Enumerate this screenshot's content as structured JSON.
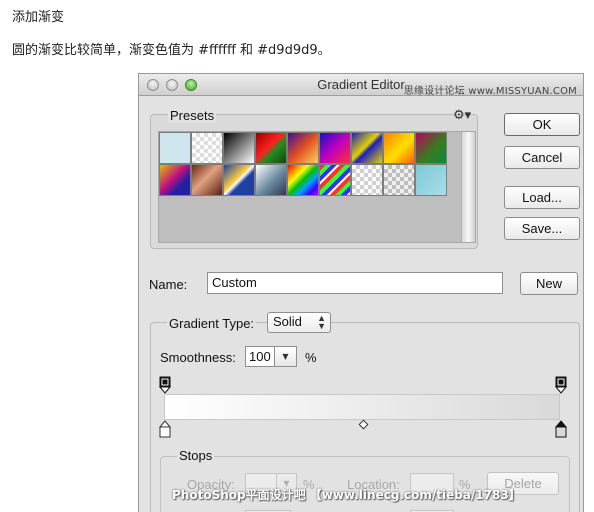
{
  "article": {
    "heading": "添加渐变",
    "body": "圆的渐变比较简单，渐变色值为 #ffffff 和 #d9d9d9。"
  },
  "window": {
    "title": "Gradient Editor",
    "watermark_top": "思缘设计论坛 www.MISSYUAN.COM"
  },
  "presets": {
    "label": "Presets",
    "swatches": [
      "linear-gradient(135deg,#cfe6ee,#cfe6ee)",
      "repeating-conic-gradient(#ddd 0 25%,#fff 0 50%) 0 0/8px 8px",
      "linear-gradient(135deg,#000,#fff)",
      "linear-gradient(135deg,#9a0000,#ff2020 45%,#2a8a20 60%,#0a4a10)",
      "linear-gradient(135deg,#3a10a0,#e05020,#ffd060)",
      "linear-gradient(135deg,#1a10c0,#c000c0,#ff3030)",
      "linear-gradient(135deg,#2020c0,#e0d000 45%,#2020c0 55%,#e0d000)",
      "linear-gradient(135deg,#ff8000,#ffe000 55%,#ff6000)",
      "linear-gradient(135deg,#c00060,#3a7a20 55%,#0a8a40)",
      "linear-gradient(135deg,#e0c000,#c01080 45%,#2020a0 70%)",
      "linear-gradient(135deg,#6a2a10,#e0a080 45%,#5a2010)",
      "linear-gradient(135deg,#2040a0,#ffd040 45%,#fff 50%,#2040a0 60%)",
      "linear-gradient(135deg,#ffffff,#6a8aa0 55%,#303850)",
      "linear-gradient(135deg,#ff0000,#ff8000,#ffff00,#00c000,#00a0ff,#4000ff,#c000ff)",
      "repeating-linear-gradient(135deg,#ff3030 0 4px,#30ff30 4px 8px,#3030ff 8px 12px,#ffffff 12px 14px)",
      "repeating-conic-gradient(#cfcfcf 0 25%,#fafafa 0 50%) 0 0/8px 8px",
      "repeating-conic-gradient(#bdbdbd 0 25%,#eeeeee 0 50%) 0 0/8px 8px",
      "linear-gradient(135deg,#7ec8d8,#a8dde8)"
    ]
  },
  "buttons": {
    "ok": "OK",
    "cancel": "Cancel",
    "load": "Load...",
    "save": "Save...",
    "new": "New",
    "delete": "Delete"
  },
  "name": {
    "label": "Name:",
    "value": "Custom"
  },
  "gradient": {
    "type_label": "Gradient Type:",
    "type_value": "Solid",
    "smoothness_label": "Smoothness:",
    "smoothness_value": "100",
    "smoothness_unit": "%",
    "start_color": "#ffffff",
    "end_color": "#d9d9d9"
  },
  "stops": {
    "label": "Stops",
    "opacity_label": "Opacity:",
    "opacity_unit": "%",
    "location_label": "Location:",
    "location_unit": "%"
  },
  "watermark_bottom": "PhotoShop平面设计吧 【www.linecg.com/tieba/1783】"
}
